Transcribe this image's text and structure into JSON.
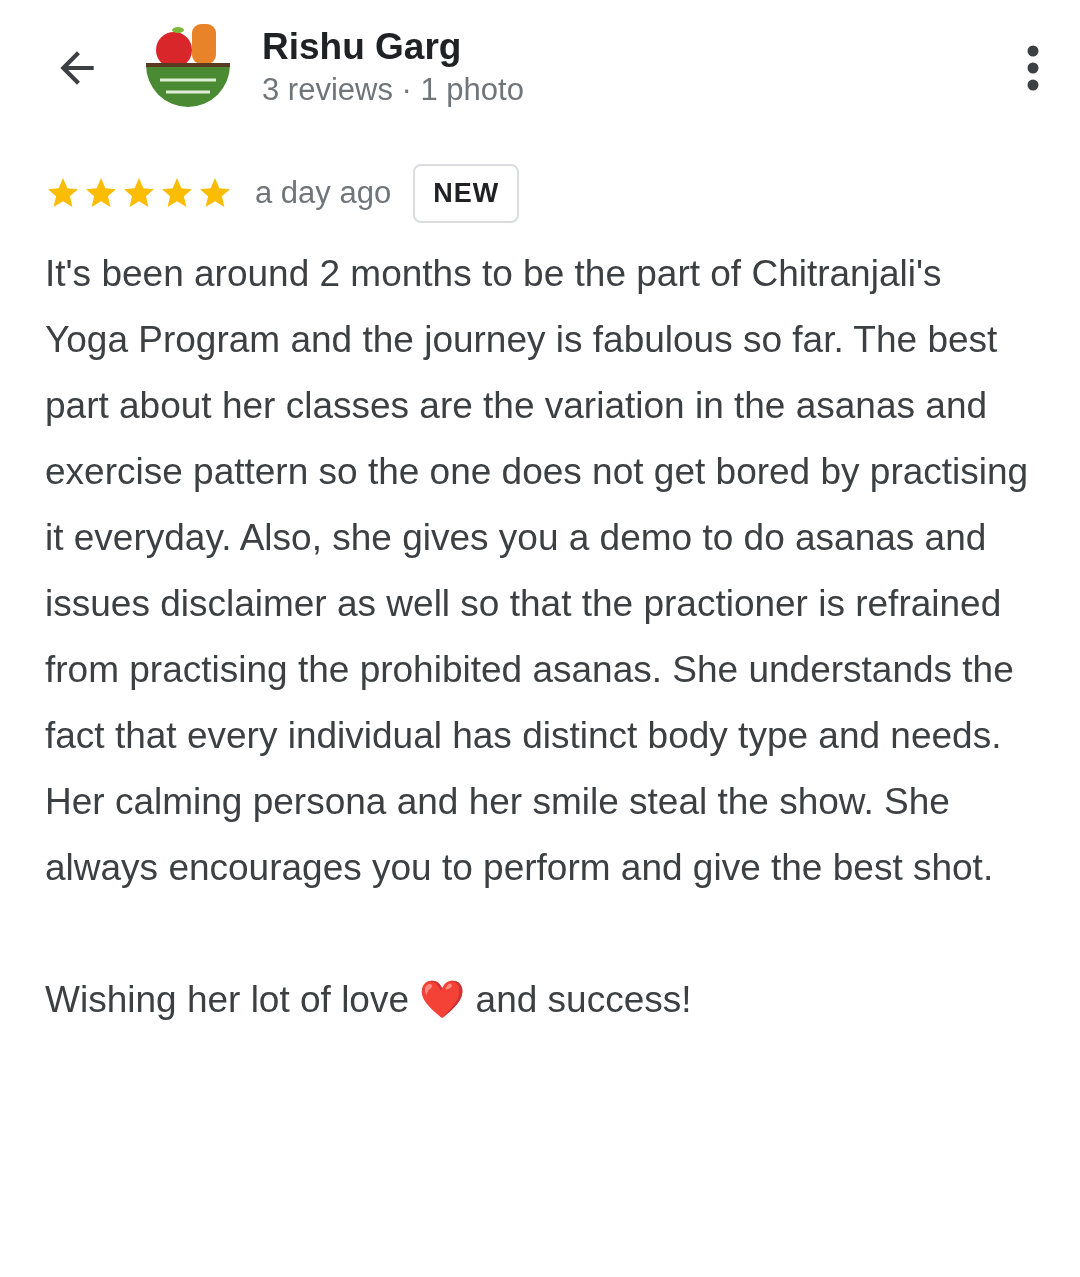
{
  "header": {
    "name": "Rishu Garg",
    "subtitle": "3 reviews · 1 photo"
  },
  "review": {
    "stars": 5,
    "time": "a day ago",
    "badge": "NEW",
    "paragraphs": [
      "It's been around 2 months to be the part of Chitranjali's Yoga Program and the journey is fabulous so far. The best part about her classes are the variation in the asanas and exercise pattern so the one does not get bored by practising it everyday. Also, she gives you a demo to do asanas and issues disclaimer as well so that the practioner is refrained from practising the prohibited asanas. She understands the fact that every individual has distinct body type and needs. Her calming persona and her smile steal the show. She always encourages you to perform and give the best shot.",
      "Wishing her lot of love ❤️ and success!"
    ]
  }
}
